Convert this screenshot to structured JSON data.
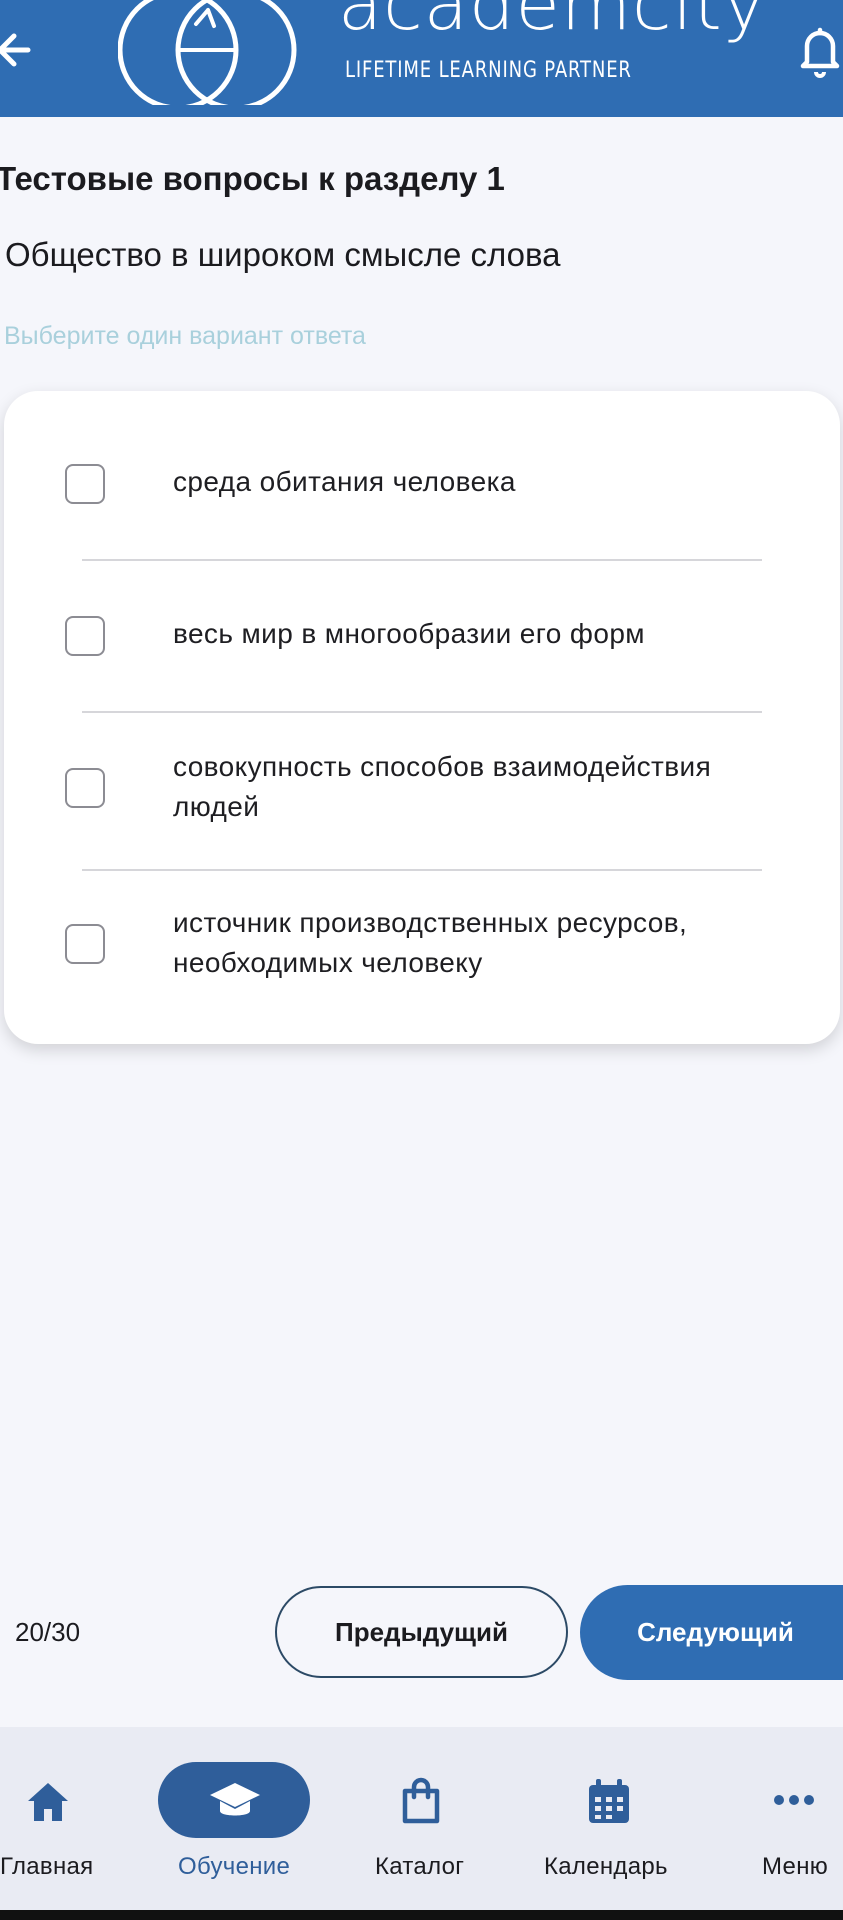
{
  "header": {
    "brand": "academcity",
    "tagline": "LIFETIME LEARNING PARTNER"
  },
  "section_title": "Тестовые вопросы к разделу 1",
  "question": "Общество в широком смысле слова",
  "hint": "Выберите один вариант ответа",
  "options": [
    {
      "text": "среда обитания человека",
      "checked": false
    },
    {
      "text": "весь мир в многообразии его форм",
      "checked": false
    },
    {
      "text": "совокупность способов взаимодействия людей",
      "checked": false
    },
    {
      "text": "источник производственных ресурсов, необходимых человеку",
      "checked": false
    }
  ],
  "pager": {
    "counter": "20/30",
    "prev_label": "Предыдущий",
    "next_label": "Следующий"
  },
  "nav": [
    {
      "label": "Главная",
      "icon": "home-icon",
      "active": false
    },
    {
      "label": "Обучение",
      "icon": "graduation-cap-icon",
      "active": true
    },
    {
      "label": "Каталог",
      "icon": "shopping-bag-icon",
      "active": false
    },
    {
      "label": "Календарь",
      "icon": "calendar-icon",
      "active": false
    },
    {
      "label": "Меню",
      "icon": "more-icon",
      "active": false
    }
  ],
  "colors": {
    "primary": "#2f6db3",
    "active_nav": "#2f5e9a",
    "hint": "#a9d0dc",
    "background": "#f5f6fb",
    "nav_background": "#e9ebf3"
  }
}
